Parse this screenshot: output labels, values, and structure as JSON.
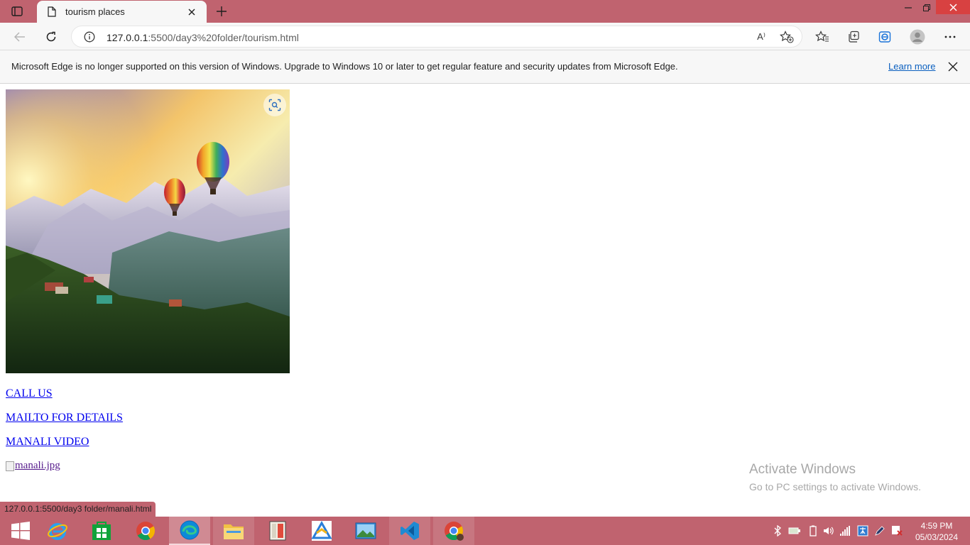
{
  "browser": {
    "tab_title": "tourism places",
    "url_host": "127.0.0.1",
    "url_path": ":5500/day3%20folder/tourism.html",
    "read_aloud_glyph": "A⁾",
    "infobar_message": "Microsoft Edge is no longer supported on this version of Windows. Upgrade to Windows 10 or later to get regular feature and security updates from Microsoft Edge.",
    "infobar_link": "Learn more"
  },
  "page": {
    "links": {
      "call": "CALL US",
      "mail": "MAILTO FOR DETAILS",
      "video": "MANALI VIDEO"
    },
    "broken_image_alt": "manali.jpg",
    "status_url": "127.0.0.1:5500/day3 folder/manali.html"
  },
  "watermark": {
    "line1": "Activate Windows",
    "line2": "Go to PC settings to activate Windows."
  },
  "taskbar": {
    "time": "4:59 PM",
    "date": "05/03/2024",
    "apps": [
      "start-icon",
      "internet-explorer-icon",
      "store-icon",
      "chrome-icon",
      "edge-icon",
      "file-explorer-icon",
      "tally-icon",
      "app-icon",
      "photos-icon",
      "vscode-icon",
      "chrome-profile-icon"
    ]
  },
  "colors": {
    "accent": "#c0636f",
    "link": "#0000ee",
    "visited": "#551a8b"
  }
}
